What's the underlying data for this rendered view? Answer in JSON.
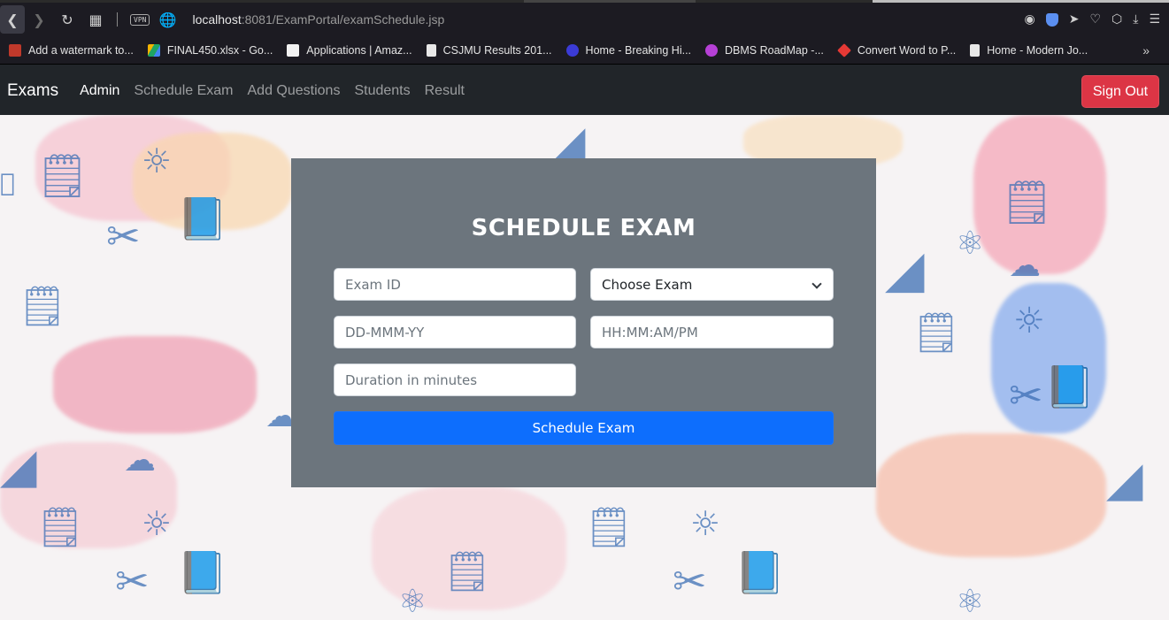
{
  "browser": {
    "url_host": "localhost",
    "url_rest": ":8081/ExamPortal/examSchedule.jsp",
    "vpn_label": "VPN",
    "bookmarks": [
      {
        "label": "Add a watermark to...",
        "color": "#c0392b"
      },
      {
        "label": "FINAL450.xlsx - Go...",
        "color": "#1fa463"
      },
      {
        "label": "Applications | Amaz...",
        "color": "#f2f2f2"
      },
      {
        "label": "CSJMU Results 201...",
        "color": "#e8e8e8"
      },
      {
        "label": "Home - Breaking Hi...",
        "color": "#3b3bd6"
      },
      {
        "label": "DBMS RoadMap -...",
        "color": "#b640d6"
      },
      {
        "label": "Convert Word to P...",
        "color": "#e53935"
      },
      {
        "label": "Home - Modern Jo...",
        "color": "#e8e8e8"
      }
    ],
    "more_glyph": "»"
  },
  "navbar": {
    "brand": "Exams",
    "links": [
      {
        "label": "Admin",
        "active": true
      },
      {
        "label": "Schedule Exam",
        "active": false
      },
      {
        "label": "Add Questions",
        "active": false
      },
      {
        "label": "Students",
        "active": false
      },
      {
        "label": "Result",
        "active": false
      }
    ],
    "signout_label": "Sign Out"
  },
  "form": {
    "title": "SCHEDULE EXAM",
    "exam_id_placeholder": "Exam ID",
    "exam_select_value": "Choose Exam",
    "date_placeholder": "DD-MMM-YY",
    "time_placeholder": "HH:MM:AM/PM",
    "duration_placeholder": "Duration in minutes",
    "submit_label": "Schedule Exam"
  },
  "colors": {
    "navbar_bg": "#212529",
    "card_bg": "#6c757d",
    "primary": "#0d6efd",
    "danger": "#dc3545"
  }
}
